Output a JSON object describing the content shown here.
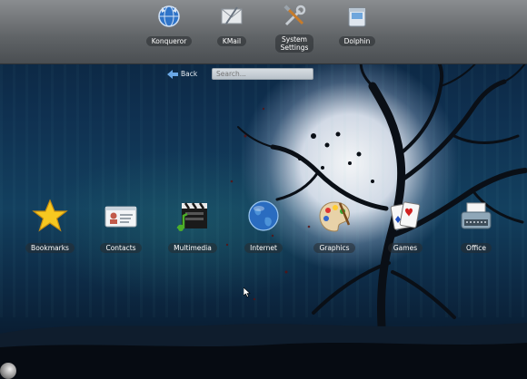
{
  "top_panel": {
    "apps": [
      {
        "label": "Konqueror",
        "icon": "konqueror-globe-icon"
      },
      {
        "label": "KMail",
        "icon": "kmail-envelope-icon"
      },
      {
        "label": "System Settings",
        "label_line1": "System",
        "label_line2": "Settings",
        "icon": "system-settings-tools-icon"
      },
      {
        "label": "Dolphin",
        "icon": "dolphin-folder-icon"
      }
    ]
  },
  "navigation": {
    "back_label": "Back",
    "search_placeholder": "Search..."
  },
  "categories": [
    {
      "label": "Bookmarks",
      "icon": "star-icon"
    },
    {
      "label": "Contacts",
      "icon": "contact-card-icon"
    },
    {
      "label": "Multimedia",
      "icon": "clapperboard-icon"
    },
    {
      "label": "Internet",
      "icon": "globe-icon"
    },
    {
      "label": "Graphics",
      "icon": "palette-icon"
    },
    {
      "label": "Games",
      "icon": "playing-cards-icon"
    },
    {
      "label": "Office",
      "icon": "typewriter-icon"
    }
  ],
  "colors": {
    "panel_top": "#8a8d90",
    "panel_bottom": "#4a4e52",
    "sky": "#13405f",
    "moon": "#ffffff"
  }
}
